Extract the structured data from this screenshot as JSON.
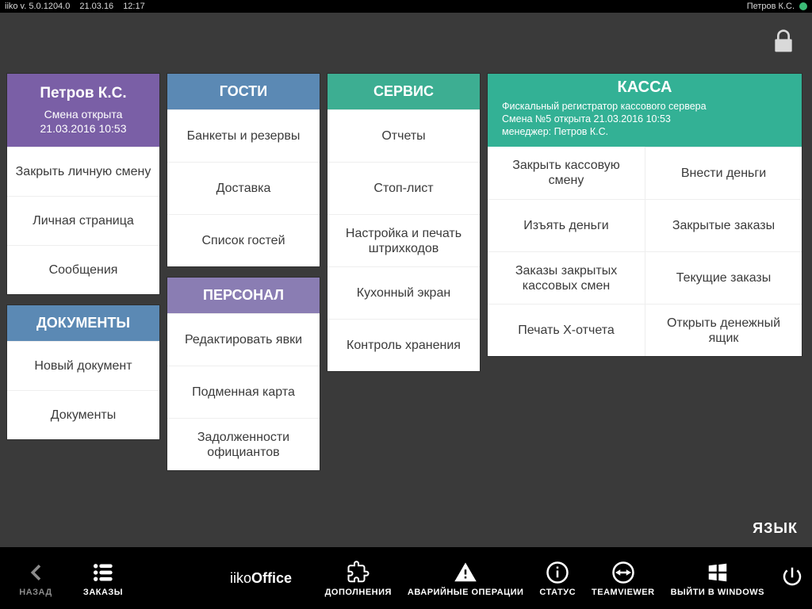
{
  "topbar": {
    "version": "iiko  v.  5.0.1204.0",
    "date": "21.03.16",
    "time": "12:17",
    "user": "Петров К.С."
  },
  "user_card": {
    "name": "Петров К.С.",
    "shift_line1": "Смена открыта",
    "shift_line2": "21.03.2016 10:53",
    "items": [
      "Закрыть личную смену",
      "Личная страница",
      "Сообщения"
    ]
  },
  "documents": {
    "title": "ДОКУМЕНТЫ",
    "items": [
      "Новый документ",
      "Документы"
    ]
  },
  "guests": {
    "title": "ГОСТИ",
    "items": [
      "Банкеты и резервы",
      "Доставка",
      "Список гостей"
    ]
  },
  "personnel": {
    "title": "ПЕРСОНАЛ",
    "items": [
      "Редактировать явки",
      "Подменная карта",
      "Задолженности официантов"
    ]
  },
  "service": {
    "title": "СЕРВИС",
    "items": [
      "Отчеты",
      "Стоп-лист",
      "Настройка и печать штрихкодов",
      "Кухонный экран",
      "Контроль хранения"
    ]
  },
  "kassa": {
    "title": "КАССА",
    "sub1": "Фискальный регистратор кассового сервера",
    "sub2": "Смена №5 открыта 21.03.2016 10:53",
    "sub3": "менеджер: Петров К.С.",
    "items": [
      "Закрыть кассовую смену",
      "Внести деньги",
      "Изъять деньги",
      "Закрытые заказы",
      "Заказы закрытых кассовых смен",
      "Текущие заказы",
      "Печать Х-отчета",
      "Открыть денежный ящик"
    ]
  },
  "language_label": "ЯЗЫК",
  "bottom": {
    "back": "НАЗАД",
    "orders": "ЗАКАЗЫ",
    "brand_light": "iiko",
    "brand_bold": "Office",
    "addons": "ДОПОЛНЕНИЯ",
    "emergency": "АВАРИЙНЫЕ ОПЕРАЦИИ",
    "status": "СТАТУС",
    "teamviewer": "TEAMVIEWER",
    "exit_windows": "ВЫЙТИ В WINDOWS"
  }
}
